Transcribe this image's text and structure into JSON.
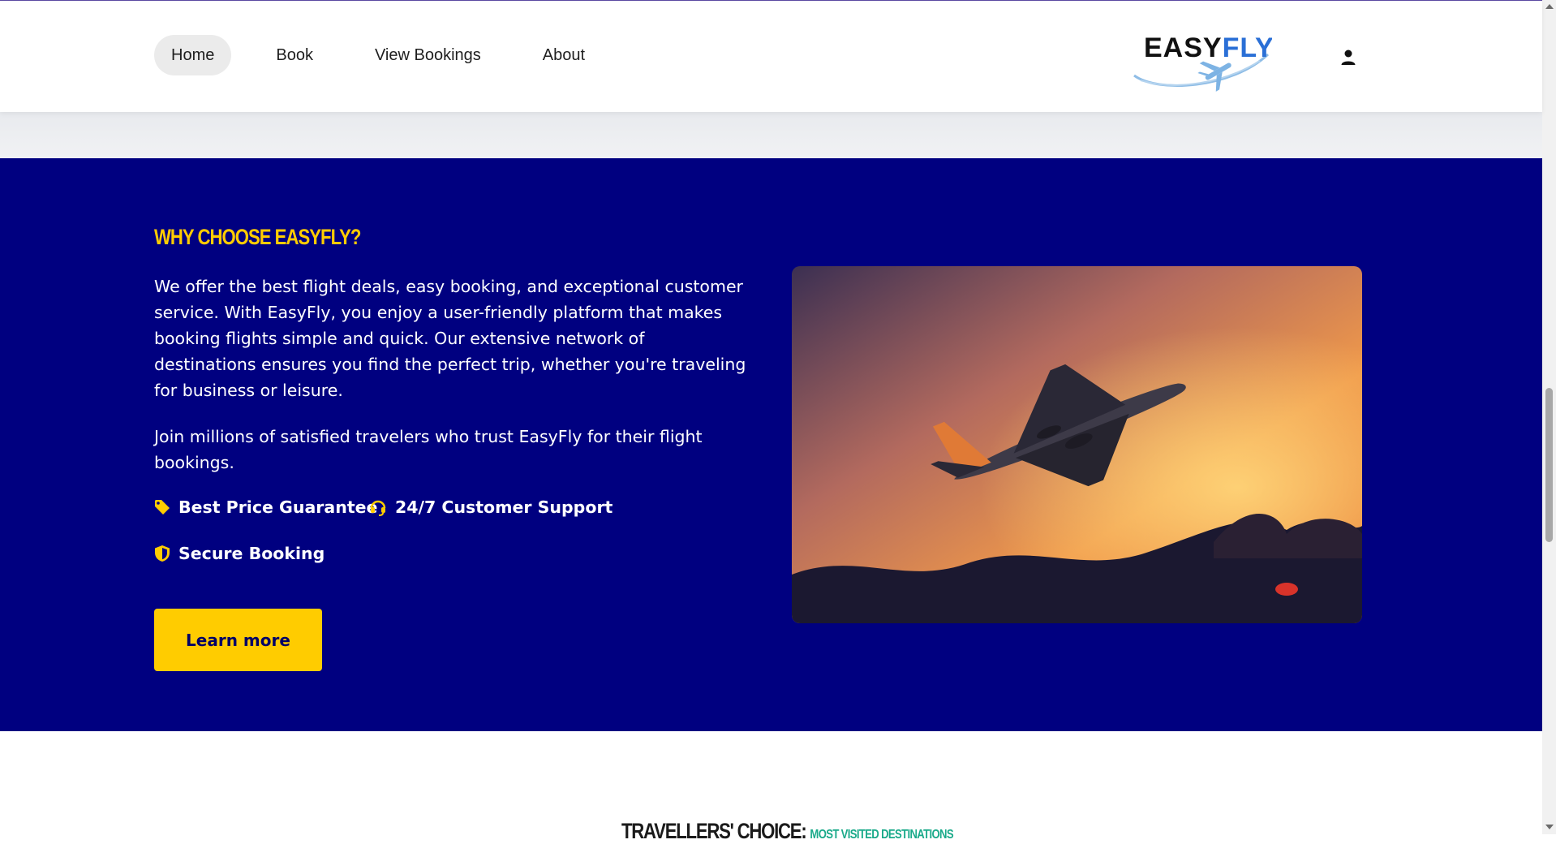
{
  "nav": {
    "items": [
      {
        "label": "Home",
        "active": true
      },
      {
        "label": "Book",
        "active": false
      },
      {
        "label": "View Bookings",
        "active": false
      },
      {
        "label": "About",
        "active": false
      }
    ]
  },
  "logo": {
    "part1": "EASY",
    "part2": "FLY"
  },
  "user": {
    "icon": "user-icon"
  },
  "why": {
    "title": "WHY CHOOSE EASYFLY?",
    "paragraph1": "We offer the best flight deals, easy booking, and exceptional customer service. With EasyFly, you enjoy a user-friendly platform that makes booking flights simple and quick. Our extensive network of destinations ensures you find the perfect trip, whether you're traveling for business or leisure.",
    "paragraph2": "Join millions of satisfied travelers who trust EasyFly for their flight bookings.",
    "features": [
      {
        "icon": "tag-icon",
        "label": "Best Price Guarantee"
      },
      {
        "icon": "headset-icon",
        "label": "24/7 Customer Support"
      },
      {
        "icon": "shield-icon",
        "label": "Secure Booking"
      }
    ],
    "button_label": "Learn more"
  },
  "travellers": {
    "title": "TRAVELLERS' CHOICE:",
    "subtitle": "MOST VISITED DESTINATIONS"
  },
  "colors": {
    "hero_bg": "#000080",
    "accent": "#ffcc00",
    "teal": "#1aaa8a"
  }
}
